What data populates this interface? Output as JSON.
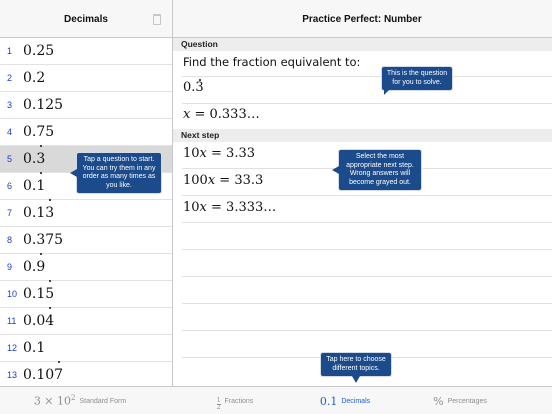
{
  "sidebar": {
    "title": "Decimals",
    "trash_icon": "trash-icon",
    "items": [
      {
        "num": "1",
        "pre": "0.25",
        "dot": "",
        "post": ""
      },
      {
        "num": "2",
        "pre": "0.2",
        "dot": "",
        "post": ""
      },
      {
        "num": "3",
        "pre": "0.125",
        "dot": "",
        "post": ""
      },
      {
        "num": "4",
        "pre": "0.75",
        "dot": "",
        "post": ""
      },
      {
        "num": "5",
        "pre": "0.",
        "dot": "3",
        "post": ""
      },
      {
        "num": "6",
        "pre": "0.",
        "dot": "1",
        "post": ""
      },
      {
        "num": "7",
        "pre": "0.1",
        "dot": "3",
        "post": ""
      },
      {
        "num": "8",
        "pre": "0.375",
        "dot": "",
        "post": ""
      },
      {
        "num": "9",
        "pre": "0.",
        "dot": "9",
        "post": ""
      },
      {
        "num": "10",
        "pre": "0.1",
        "dot": "5",
        "post": ""
      },
      {
        "num": "11",
        "pre": "0.0",
        "dot": "4",
        "post": ""
      },
      {
        "num": "12",
        "pre": "0.1",
        "dot": "",
        "post": ""
      },
      {
        "num": "13",
        "pre": "0.10",
        "dot": "7",
        "post": ""
      }
    ],
    "selected_index": 4
  },
  "header": {
    "title": "Practice Perfect: Number"
  },
  "question": {
    "section_label": "Question",
    "prompt": "Find the fraction equivalent to:",
    "value_pre": "0.",
    "value_dot": "3",
    "setup_var": "x",
    "setup_rest": " = 0.333…"
  },
  "next_step": {
    "section_label": "Next step",
    "options": [
      {
        "coef": "10",
        "var": "x",
        "rest": " = 3.33"
      },
      {
        "coef": "100",
        "var": "x",
        "rest": " = 33.3"
      },
      {
        "coef": "10",
        "var": "x",
        "rest": " = 3.333…"
      }
    ]
  },
  "tooltips": {
    "question": "This is the question for you to solve.",
    "start": "Tap a question to start. You can try them in any order as many times as you like.",
    "step": "Select the most appropriate next step. Wrong answers will become grayed out.",
    "topics": "Tap here to choose different topics."
  },
  "tabs": [
    {
      "icon_main": "3 × 10",
      "icon_sup": "2",
      "label": "Standard Form"
    },
    {
      "icon_num": "1",
      "icon_den": "2",
      "label": "Fractions"
    },
    {
      "icon_main": "0.1",
      "label": "Decimals"
    },
    {
      "icon_main": "%",
      "label": "Percentages"
    }
  ],
  "active_tab": 2,
  "colors": {
    "accent": "#1d5fd6",
    "tooltip": "#1c4b8c",
    "number": "#1a3ec4"
  }
}
